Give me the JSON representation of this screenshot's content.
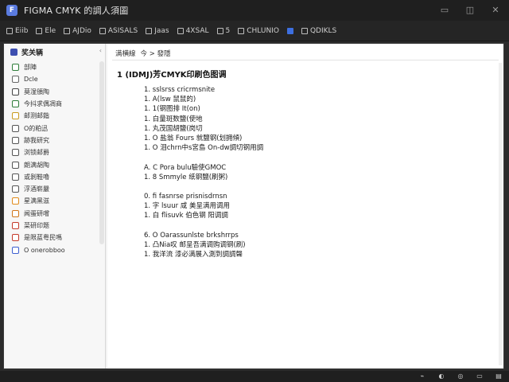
{
  "window": {
    "title": "FIGMA CMYK 的調人須圖",
    "controls": [
      "minimize",
      "maximize",
      "close"
    ]
  },
  "toolbar": {
    "items": [
      {
        "label": "Eiib",
        "icon": "file-icon"
      },
      {
        "label": "Ele",
        "icon": "edit-icon"
      },
      {
        "label": "AJDio",
        "icon": "view-icon"
      },
      {
        "label": "ASISALS",
        "icon": "insert-icon"
      },
      {
        "label": "Jaas",
        "icon": "format-icon"
      },
      {
        "label": "4XSAL",
        "icon": "tools-icon"
      },
      {
        "label": "5",
        "icon": "page-icon"
      },
      {
        "label": "CHLUNIO",
        "icon": "plugin-icon"
      },
      {
        "label": "",
        "icon": "blue-doc-icon"
      },
      {
        "label": "QDIKLS",
        "icon": "help-icon"
      }
    ]
  },
  "sidebar": {
    "title": "奖关辆",
    "items": [
      {
        "label": "部陣",
        "color": "#2f7d3a"
      },
      {
        "label": "Dcle",
        "color": "#666666"
      },
      {
        "label": "莫湿頒陶",
        "color": "#444444"
      },
      {
        "label": "今抖求偶凋商",
        "color": "#2f7d3a"
      },
      {
        "label": "邮测邮鍇",
        "color": "#c99a1e"
      },
      {
        "label": "O的粕迅",
        "color": "#555555"
      },
      {
        "label": "跡我研究",
        "color": "#555555"
      },
      {
        "label": "浏锁邮爵",
        "color": "#555555"
      },
      {
        "label": "朗满胡陶",
        "color": "#555555"
      },
      {
        "label": "或剝鞋嚕",
        "color": "#555555"
      },
      {
        "label": "浮酒崭嚴",
        "color": "#555555"
      },
      {
        "label": "星满黑滋",
        "color": "#e08a1a"
      },
      {
        "label": "闻蛋研嚐",
        "color": "#d0761a"
      },
      {
        "label": "菜研印题",
        "color": "#c53a2a"
      },
      {
        "label": "是限蓝粤民嗎",
        "color": "#c53a2a"
      },
      {
        "label": "O onerobboo",
        "color": "#3d5fd0"
      }
    ]
  },
  "content": {
    "breadcrumb": [
      "满横線",
      "今 > 發隱"
    ],
    "title": "1  (IDMJ)芳CMYK印刷色图调",
    "lines": [
      "1. sslsrss cricrmsnite",
      "1. A(lsw 鼠鼠的)",
      "1. 1(钢图排 It(on)",
      "1. 白量斑数鹽(使地",
      "1. 丸茂国胡鹽(岗切",
      "1. O 盐翁 Fours 就鹽钢(划拥傾)",
      "1. O 泪chrn中s宮島 On-dw調切钢用調",
      "",
      "A. C Pora bulu驗使GMOC",
      "1. 8 Smmyle 纸钢鹽(刷粥)",
      "",
      "0. fi fasnrse prisnisdrnsn",
      "1. 字 lsuur 咸 美呈满用调用",
      "1. 白 flisuvk 伯色钢 阳调調",
      "",
      "6. O Oarassunlste brkshrrps",
      "1. 凸Nia叹 邮呈吾满调购调钢(刷)",
      "1. 我洋流  漆必满展入測到調調聲"
    ]
  },
  "statusbar": {
    "icons": [
      "network-icon",
      "volume-icon",
      "battery-icon",
      "keyboard-icon",
      "notification-icon"
    ]
  }
}
